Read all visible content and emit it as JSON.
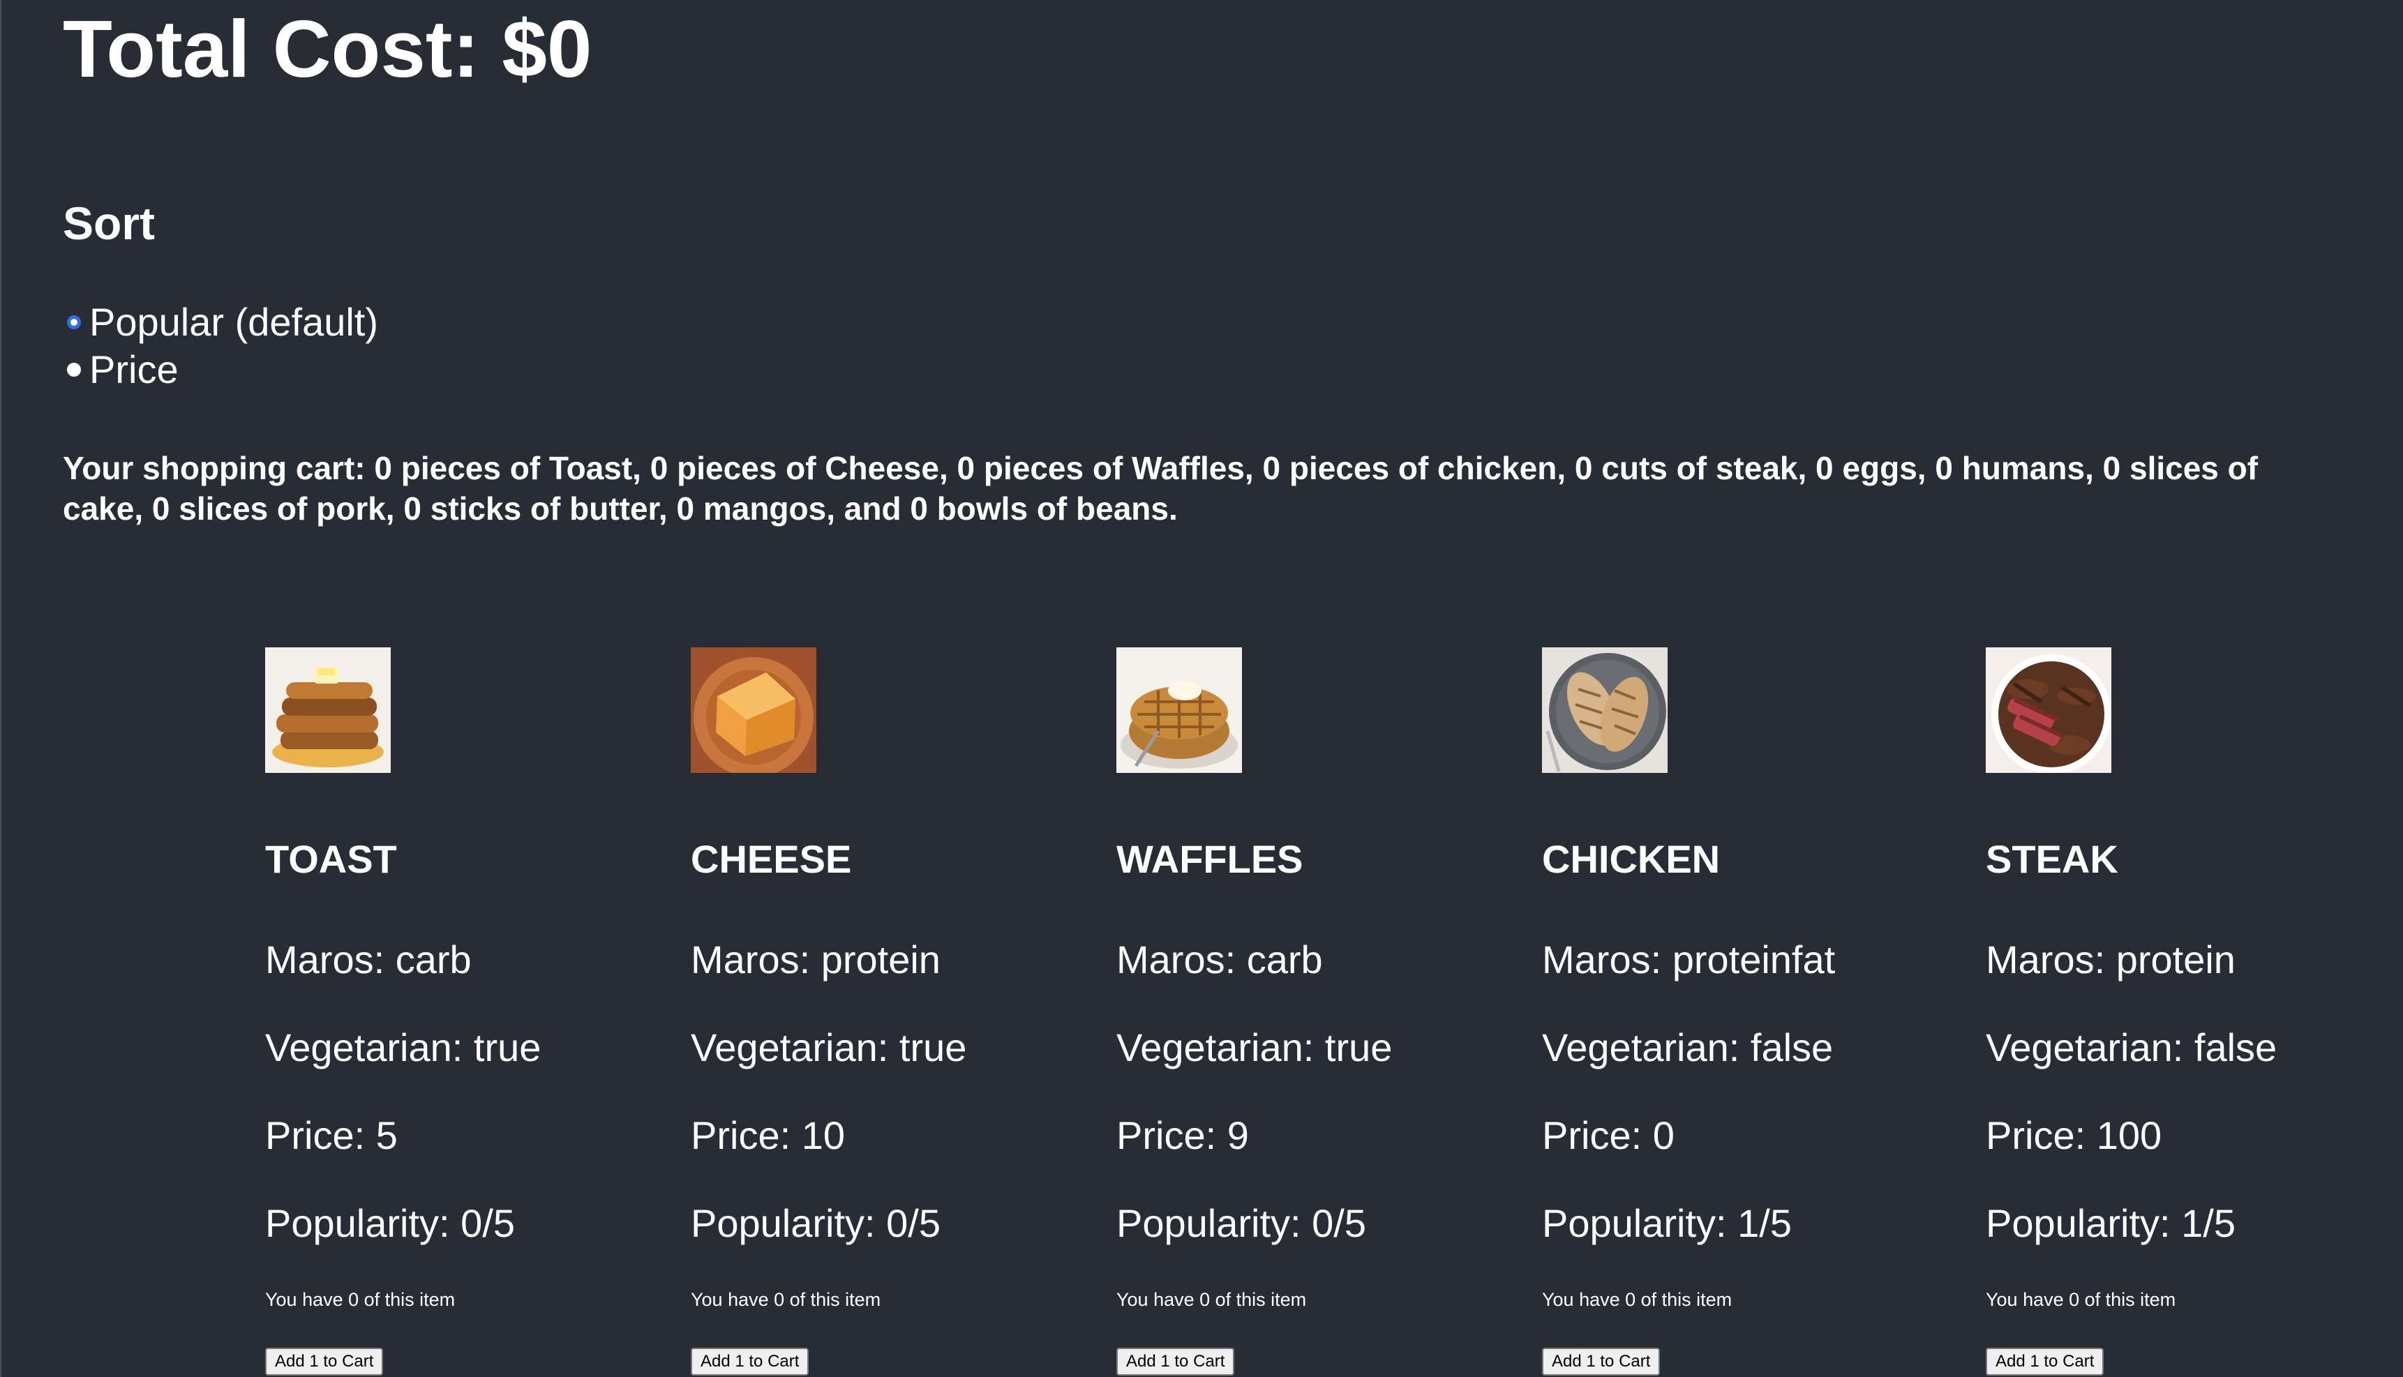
{
  "header": {
    "total_cost": "Total Cost: $0"
  },
  "sort": {
    "title": "Sort",
    "options": [
      {
        "label": "Popular (default)",
        "selected": true
      },
      {
        "label": "Price",
        "selected": false
      }
    ]
  },
  "cart": {
    "summary": "Your shopping cart: 0 pieces of Toast, 0 pieces of Cheese, 0 pieces of Waffles, 0 pieces of chicken, 0 cuts of steak, 0 eggs, 0 humans, 0 slices of cake, 0 slices of pork, 0 sticks of butter, 0 mangos, and 0 bowls of beans."
  },
  "items": [
    {
      "name": "TOAST",
      "image_icon": "french-toast-image",
      "macros": "Maros: carb",
      "vegetarian": "Vegetarian: true",
      "price": "Price: 5",
      "popularity": "Popularity: 0/5",
      "have": "You have 0 of this item",
      "button": "Add 1 to Cart"
    },
    {
      "name": "CHEESE",
      "image_icon": "cheese-image",
      "macros": "Maros: protein",
      "vegetarian": "Vegetarian: true",
      "price": "Price: 10",
      "popularity": "Popularity: 0/5",
      "have": "You have 0 of this item",
      "button": "Add 1 to Cart"
    },
    {
      "name": "WAFFLES",
      "image_icon": "waffles-image",
      "macros": "Maros: carb",
      "vegetarian": "Vegetarian: true",
      "price": "Price: 9",
      "popularity": "Popularity: 0/5",
      "have": "You have 0 of this item",
      "button": "Add 1 to Cart"
    },
    {
      "name": "CHICKEN",
      "image_icon": "chicken-image",
      "macros": "Maros: proteinfat",
      "vegetarian": "Vegetarian: false",
      "price": "Price: 0",
      "popularity": "Popularity: 1/5",
      "have": "You have 0 of this item",
      "button": "Add 1 to Cart"
    },
    {
      "name": "STEAK",
      "image_icon": "steak-image",
      "macros": "Maros: protein",
      "vegetarian": "Vegetarian: false",
      "price": "Price: 100",
      "popularity": "Popularity: 1/5",
      "have": "You have 0 of this item",
      "button": "Add 1 to Cart"
    }
  ],
  "colors": {
    "background": "#282c34",
    "text": "#ffffff",
    "radio_accent": "#2f6fe4"
  }
}
